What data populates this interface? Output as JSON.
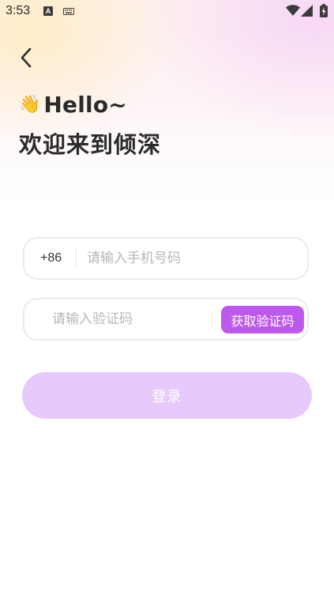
{
  "status_bar": {
    "time": "3:53",
    "notification_badge": "A",
    "icons": [
      "keyboard-icon",
      "wifi-icon",
      "signal-icon",
      "battery-charging-icon"
    ]
  },
  "header": {
    "back_icon": "chevron-left-icon",
    "greeting_emoji": "👋",
    "greeting": "Hello~",
    "welcome": "欢迎来到倾深"
  },
  "form": {
    "country_code": "+86",
    "phone_placeholder": "请输入手机号码",
    "phone_value": "",
    "code_placeholder": "请输入验证码",
    "code_value": "",
    "get_code_label": "获取验证码",
    "login_label": "登录"
  },
  "colors": {
    "accent": "#bd58ec",
    "login_disabled": "#e8c9fb",
    "text_primary": "#2b2b2b",
    "placeholder": "#b7b7b7"
  }
}
